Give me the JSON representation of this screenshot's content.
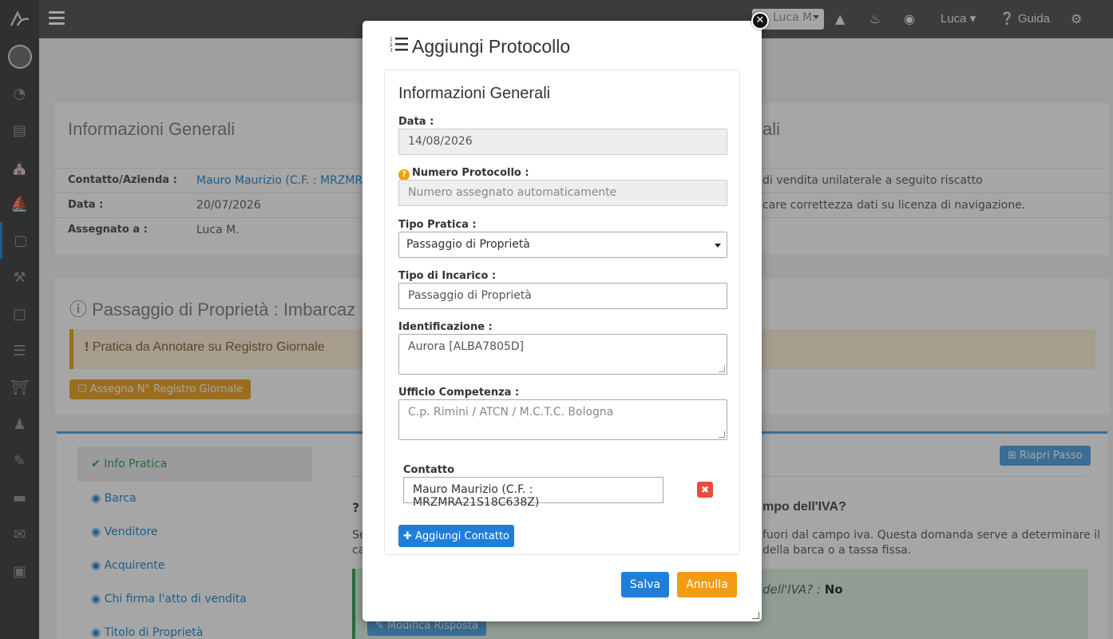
{
  "topbar": {
    "select_value": "Luca M.",
    "user": "Luca",
    "help": "Guida"
  },
  "background": {
    "left_card": {
      "title": "Informazioni Generali",
      "rows": [
        {
          "label": "Contatto/Azienda :",
          "value": "Mauro Maurizio (C.F. : MRZMRA"
        },
        {
          "label": "Data :",
          "value": "20/07/2026"
        },
        {
          "label": "Assegnato a :",
          "value": "Luca M."
        }
      ]
    },
    "right_card": {
      "title_fragment": "ali",
      "line1": "di vendita unilaterale a seguito riscatto",
      "line2": "care correttezza dati su licenza di navigazione."
    },
    "section_title": "Passaggio di Proprietà : Imbarcaz",
    "warning": "Pratica da Annotare su Registro Giornale",
    "assign_button": "Assegna N° Registro Giornale",
    "reopen_button": "Riapri Passo",
    "nav": [
      "Info Pratica",
      "Barca",
      "Venditore",
      "Acquirente",
      "Chi firma l'atto di vendita",
      "Titolo di Proprietà"
    ],
    "question_fragment": "mpo dell'IVA?",
    "desc_line1": "fuori dal campo iva. Questa domanda serve a determinare il",
    "desc_line2": "della barca o a tassa fissa.",
    "desc_left1": "Se",
    "desc_left2": "ca",
    "answer_fragment": "dell'IVA? :",
    "answer_value": "No",
    "edit_answer": "Modifica Risposta"
  },
  "modal": {
    "title": "Aggiungi Protocollo",
    "panel_title": "Informazioni Generali",
    "data_label": "Data :",
    "data_value": "14/08/2026",
    "protocol_label": "Numero Protocollo :",
    "protocol_placeholder": "Numero assegnato automaticamente",
    "tipo_pratica_label": "Tipo Pratica :",
    "tipo_pratica_value": "Passaggio di Proprietà",
    "tipo_incarico_label": "Tipo di Incarico :",
    "tipo_incarico_value": "Passaggio di Proprietà",
    "identificazione_label": "Identificazione :",
    "identificazione_value": "Aurora [ALBA7805D]",
    "ufficio_label": "Ufficio Competenza :",
    "ufficio_placeholder": "C.p. Rimini / ATCN / M.C.T.C. Bologna",
    "contatto_label": "Contatto",
    "contatto_value": "Mauro Maurizio (C.F. : MRZMRA21S18C638Z)",
    "add_contact": "Aggiungi Contatto",
    "save": "Salva",
    "cancel": "Annulla"
  },
  "colors": {
    "primary": "#1f7fd8",
    "warning": "#f39c12",
    "danger": "#e74c3c",
    "sidebar": "#4a4a4a"
  }
}
